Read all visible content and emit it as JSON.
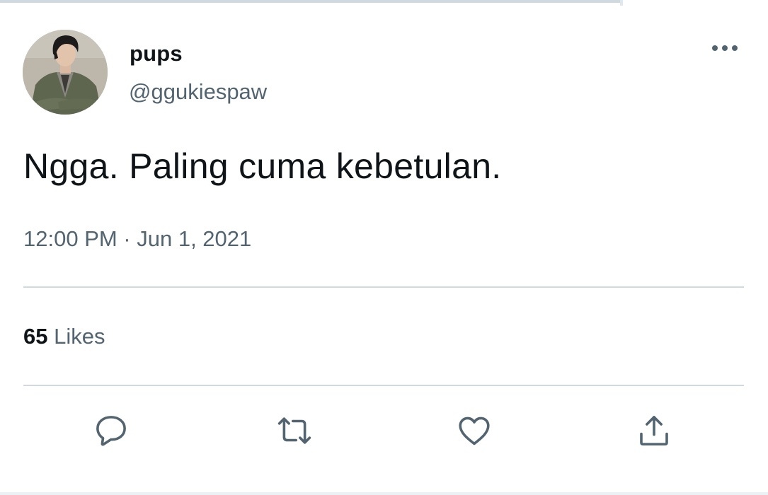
{
  "tweet": {
    "author": {
      "display_name": "pups",
      "handle": "@ggukiespaw",
      "avatar": "profile-photo"
    },
    "text": "Ngga. Paling cuma kebetulan.",
    "timestamp": "12:00 PM · Jun 1, 2021",
    "stats": {
      "likes_count": "65",
      "likes_label": "Likes"
    },
    "actions": [
      {
        "name": "reply",
        "icon": "speech-bubble-icon"
      },
      {
        "name": "retweet",
        "icon": "retweet-arrows-icon"
      },
      {
        "name": "like",
        "icon": "heart-icon"
      },
      {
        "name": "share",
        "icon": "share-upload-icon"
      }
    ],
    "more_menu_icon": "ellipsis-icon"
  },
  "colors": {
    "primary_text": "#0f1419",
    "secondary_text": "#536471",
    "divider": "#cfd9de",
    "background": "#ffffff"
  }
}
